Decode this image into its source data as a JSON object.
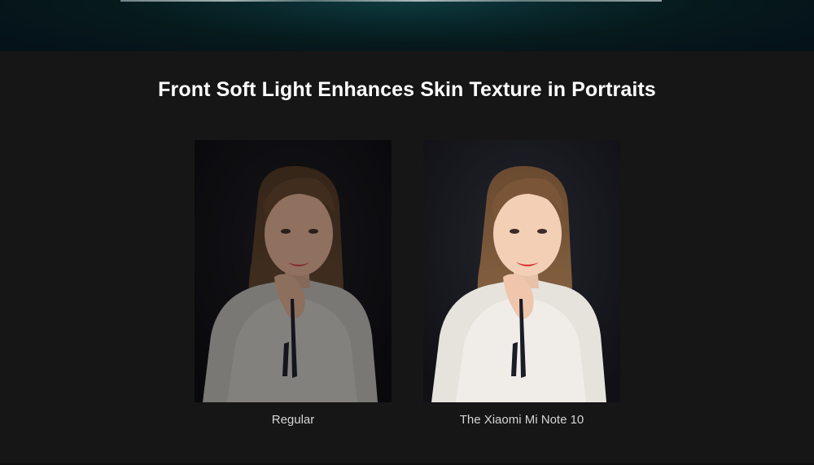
{
  "section": {
    "title": "Front Soft Light Enhances Skin Texture in Portraits"
  },
  "comparison": [
    {
      "caption": "Regular",
      "icon": "portrait-photo-regular"
    },
    {
      "caption": "The Xiaomi Mi Note 10",
      "icon": "portrait-photo-enhanced"
    }
  ],
  "colors": {
    "page_background": "#161616",
    "banner": "#0a2a2e",
    "title_text": "#ffffff",
    "caption_text": "#d6d6d6"
  }
}
